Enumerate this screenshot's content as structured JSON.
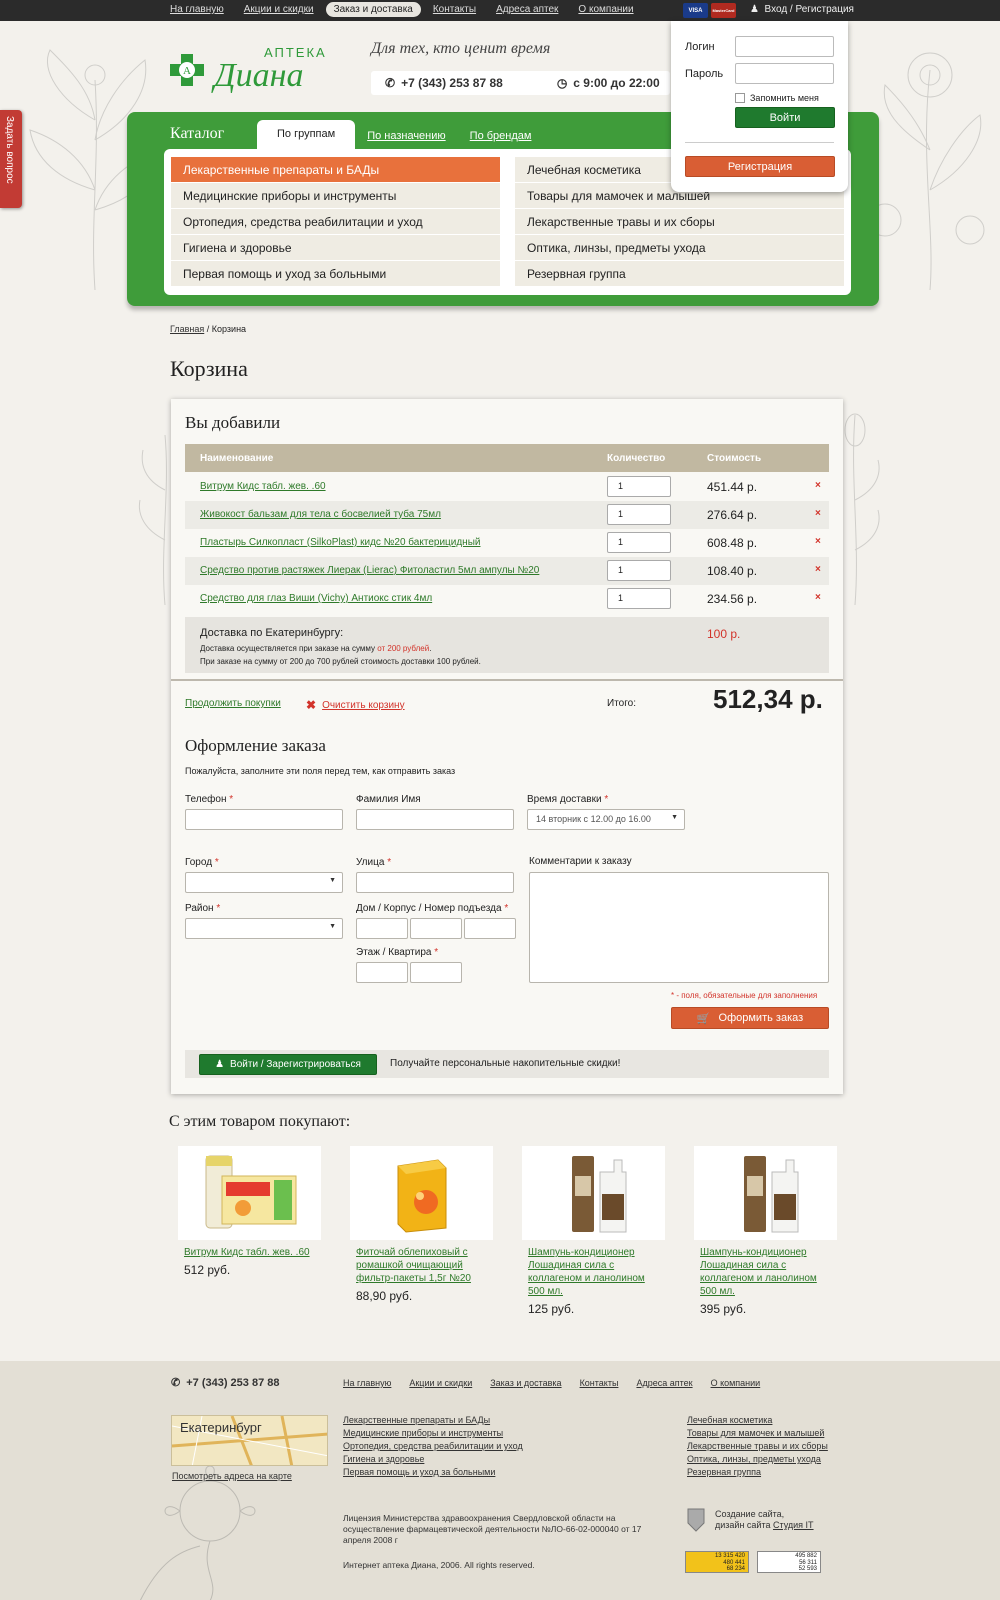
{
  "topbar": {
    "nav": [
      "На главную",
      "Акции и скидки",
      "Заказ и доставка",
      "Контакты",
      "Адреса аптек",
      "О компании"
    ],
    "active_index": 2,
    "cards": [
      "VISA",
      "MasterCard"
    ],
    "login_link": "Вход / Регистрация"
  },
  "login": {
    "login_label": "Логин",
    "password_label": "Пароль",
    "remember_label": "Запомнить меня",
    "submit_label": "Войти",
    "register_label": "Регистрация"
  },
  "header": {
    "logo_small": "АПТЕКА",
    "logo_big": "Диана",
    "slogan": "Для тех, кто ценит время",
    "phone": "+7 (343) 253 87 88",
    "hours": "с 9:00 до 22:00"
  },
  "ask_tab": "Задать вопрос",
  "catalog": {
    "title": "Каталог",
    "tabs": [
      "По группам",
      "По назначению",
      "По брендам"
    ],
    "left": [
      "Лекарственные препараты и БАДы",
      "Медицинские приборы и инструменты",
      "Ортопедия, средства реабилитации и уход",
      "Гигиена и здоровье",
      "Первая помощь и уход за больными"
    ],
    "right": [
      "Лечебная косметика",
      "Товары для мамочек и малышей",
      "Лекарственные травы и их сборы",
      "Оптика, линзы, предметы ухода",
      "Резервная группа"
    ]
  },
  "breadcrumb": {
    "home": "Главная",
    "sep": " / ",
    "current": "Корзина"
  },
  "page_title": "Корзина",
  "cart": {
    "heading": "Вы добавили",
    "col_name": "Наименование",
    "col_qty": "Количество",
    "col_price": "Стоимость",
    "items": [
      {
        "name": "Витрум Кидс табл. жев. .60",
        "qty": "1",
        "price": "451.44 р."
      },
      {
        "name": "Живокост бальзам для тела с босвелией туба 75мл",
        "qty": "1",
        "price": "276.64 р."
      },
      {
        "name": "Пластырь Силкопласт (SilkoPlast) кидс №20 бактерицидный",
        "qty": "1",
        "price": "608.48 р."
      },
      {
        "name": "Средство против растяжек Лиерак (Lierac) Фитоластил 5мл ампулы №20",
        "qty": "1",
        "price": "108.40 р."
      },
      {
        "name": "Средство для глаз Виши (Vichy) Антиокс стик 4мл",
        "qty": "1",
        "price": "234.56 р."
      }
    ],
    "delete_symbol": "×",
    "delivery_title": "Доставка по Екатеринбургу:",
    "delivery_note_a": "Доставка осуществляется при заказе на сумму ",
    "delivery_note_b": "от 200 рублей",
    "delivery_note_c": ".",
    "delivery_note2": "При заказе на сумму от 200 до 700 рублей стоимость доставки 100 рублей.",
    "delivery_price": "100 р.",
    "continue_label": "Продолжить покупки",
    "clear_label": "Очистить корзину",
    "total_label": "Итого:",
    "total": "512,34 р."
  },
  "order": {
    "heading": "Оформление заказа",
    "subtitle": "Пожалуйста, заполните эти поля перед тем, как отправить заказ",
    "phone_label": "Телефон",
    "name_label": "Фамилия Имя",
    "time_label": "Время доставки",
    "time_value": "14 вторник с 12.00 до 16.00",
    "city_label": "Город",
    "street_label": "Улица",
    "comment_label": "Комментарии к заказу",
    "district_label": "Район",
    "house_label": "Дом / Корпус / Номер подъезда",
    "floor_label": "Этаж / Квартира",
    "req_star": "*",
    "req_note": "* - поля, обязательные для заполнения",
    "submit_label": "Оформить заказ",
    "promo_button": "Войти /  Зарегистрироваться",
    "promo_text": "Получайте персональные накопительные скидки!"
  },
  "recommended": {
    "heading": "С этим товаром покупают:",
    "items": [
      {
        "name": "Витрум Кидс табл. жев. .60",
        "price": "512 руб.",
        "img": "vitrum-box"
      },
      {
        "name": "Фиточай облепиховый с ромашкой очищающий фильтр-пакеты 1,5г №20",
        "price": "88,90 руб.",
        "img": "tea-box"
      },
      {
        "name": "Шампунь-кондиционер Лошадиная сила с коллагеном и ланолином 500 мл.",
        "price": "125 руб.",
        "img": "shampoo-bottle"
      },
      {
        "name": "Шампунь-кондиционер Лошадиная сила с коллагеном и ланолином 500 мл.",
        "price": "395 руб.",
        "img": "shampoo-bottle"
      }
    ]
  },
  "footer": {
    "phone": "+7 (343) 253 87 88",
    "nav": [
      "На главную",
      "Акции и скидки",
      "Заказ и доставка",
      "Контакты",
      "Адреса аптек",
      "О компании"
    ],
    "map_city": "Екатеринбург",
    "map_link": "Посмотреть адреса на карте",
    "col1": [
      "Лекарственные препараты и БАДы",
      "Медицинские приборы и инструменты",
      "Ортопедия, средства реабилитации и уход",
      "Гигиена и здоровье",
      "Первая помощь и уход за больными"
    ],
    "col2": [
      "Лечебная косметика",
      "Товары для мамочек и малышей",
      "Лекарственные травы и их сборы",
      "Оптика, линзы, предметы ухода",
      "Резервная группа"
    ],
    "license": "Лицензия Министерства здравоохранения Свердловской области  на осуществление фармацевтической деятельности  №ЛО-66-02-000040 от 17 апреля 2008 г",
    "copyright": "Интернет аптека Диана, 2006. All rights reserved.",
    "studio_line1": "Создание сайта,",
    "studio_line2": "дизайн сайта ",
    "studio_link": "Студия IT",
    "counter1": [
      "13 315 420",
      "480 441",
      "68 234"
    ],
    "counter2": [
      "495 882",
      "56 311",
      "52 593"
    ]
  },
  "colors": {
    "green": "#3f9c3a",
    "orange": "#e8713c",
    "red": "#d2332a",
    "dark_green": "#1f7a2e"
  }
}
